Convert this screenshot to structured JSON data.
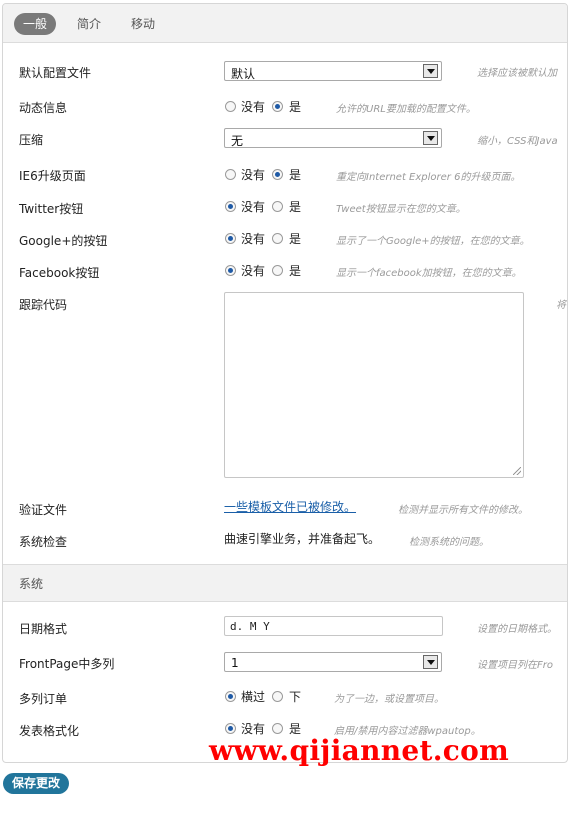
{
  "tabs": [
    {
      "label": "一般",
      "active": true
    },
    {
      "label": "简介",
      "active": false
    },
    {
      "label": "移动",
      "active": false
    }
  ],
  "general": {
    "profile": {
      "label": "默认配置文件",
      "value": "默认",
      "hint": "选择应该被默认加"
    },
    "dynamic_info": {
      "label": "动态信息",
      "options": [
        "没有",
        "是"
      ],
      "selected": "是",
      "hint": "允许的URL要加载的配置文件。"
    },
    "compression": {
      "label": "压缩",
      "value": "无",
      "hint": "缩小，CSS和Java"
    },
    "ie6": {
      "label": "IE6升级页面",
      "options": [
        "没有",
        "是"
      ],
      "selected": "是",
      "hint": "重定向Internet Explorer 6的升级页面。"
    },
    "twitter": {
      "label": "Twitter按钮",
      "options": [
        "没有",
        "是"
      ],
      "selected": "没有",
      "hint": "Tweet按钮显示在您的文章。"
    },
    "google": {
      "label": "Google+的按钮",
      "options": [
        "没有",
        "是"
      ],
      "selected": "没有",
      "hint": "显示了一个Google+的按钮，在您的文章。"
    },
    "facebook": {
      "label": "Facebook按钮",
      "options": [
        "没有",
        "是"
      ],
      "selected": "没有",
      "hint": "显示一个facebook加按钮，在您的文章。"
    },
    "tracking": {
      "label": "跟踪代码",
      "hint": "将"
    },
    "verify": {
      "label": "验证文件",
      "link": "一些模板文件已被修改。",
      "hint": "检测并显示所有文件的修改。"
    },
    "system_check": {
      "label": "系统检查",
      "value": "曲速引擎业务，并准备起飞。",
      "hint": "检测系统的问题。"
    }
  },
  "system": {
    "section_title": "系统",
    "date_format": {
      "label": "日期格式",
      "value": "d. M Y",
      "hint": "设置的日期格式。"
    },
    "multi_columns": {
      "label": "FrontPage中多列",
      "value": "1",
      "hint": "设置项目列在Fro"
    },
    "multi_order": {
      "label": "多列订单",
      "options": [
        "横过",
        "下"
      ],
      "selected": "横过",
      "hint": "为了一边，或设置项目。"
    },
    "formatting": {
      "label": "发表格式化",
      "options": [
        "没有",
        "是"
      ],
      "selected": "没有",
      "hint": "启用/禁用内容过滤器wpautop。"
    }
  },
  "save_label": "保存更改",
  "watermark": "www.qijiannet.com",
  "colors": {
    "accent": "#21759b",
    "radio_dot": "#1f5aa6",
    "watermark": "#ff0000"
  }
}
